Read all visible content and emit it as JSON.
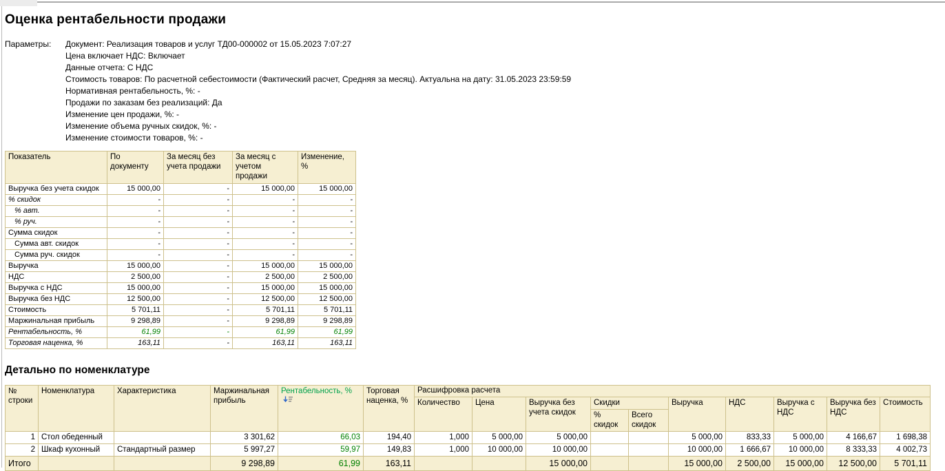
{
  "page": {
    "title": "Оценка рентабельности продажи",
    "section_heading": "Детально по номенклатуре"
  },
  "icons": {
    "sort": "sort-descending-icon"
  },
  "colors": {
    "header_bg": "#f6efd2",
    "grid_border": "#cdc08b",
    "green_value": "#008000",
    "green_header": "#00a14b",
    "sort_arrow": "#2e66c9"
  },
  "parameters": {
    "label": "Параметры:",
    "lines": [
      "Документ: Реализация товаров и услуг ТД00-000002 от 15.05.2023 7:07:27",
      "Цена включает НДС: Включает",
      "Данные отчета: С НДС",
      "Стоимость товаров: По расчетной себестоимости (Фактический расчет, Средняя за месяц). Актуальна на дату: 31.05.2023 23:59:59",
      "Нормативная рентабельность, %: -",
      "Продажи по заказам без реализаций: Да",
      "Изменение цен продажи, %: -",
      "Изменение объема ручных скидок, %: -",
      "Изменение стоимости товаров, %: -"
    ]
  },
  "summary_table": {
    "columns": [
      "Показатель",
      "По документу",
      "За месяц без учета продажи",
      "За месяц с учетом продажи",
      "Изменение, %"
    ],
    "rows": [
      {
        "label": "Выручка без учета скидок",
        "indent": 0,
        "italic": false,
        "green": false,
        "values": [
          "15 000,00",
          "-",
          "15 000,00",
          "15 000,00"
        ]
      },
      {
        "label": "% скидок",
        "indent": 0,
        "italic": true,
        "green": false,
        "values": [
          "-",
          "-",
          "-",
          "-"
        ]
      },
      {
        "label": "% авт.",
        "indent": 1,
        "italic": true,
        "green": false,
        "values": [
          "-",
          "-",
          "-",
          "-"
        ]
      },
      {
        "label": "% руч.",
        "indent": 1,
        "italic": true,
        "green": false,
        "values": [
          "-",
          "-",
          "-",
          "-"
        ]
      },
      {
        "label": "Сумма скидок",
        "indent": 0,
        "italic": false,
        "green": false,
        "values": [
          "-",
          "-",
          "-",
          "-"
        ]
      },
      {
        "label": "Сумма авт. скидок",
        "indent": 1,
        "italic": false,
        "green": false,
        "values": [
          "-",
          "-",
          "-",
          "-"
        ]
      },
      {
        "label": "Сумма руч. скидок",
        "indent": 1,
        "italic": false,
        "green": false,
        "values": [
          "-",
          "-",
          "-",
          "-"
        ]
      },
      {
        "label": "Выручка",
        "indent": 0,
        "italic": false,
        "green": false,
        "values": [
          "15 000,00",
          "-",
          "15 000,00",
          "15 000,00"
        ]
      },
      {
        "label": "НДС",
        "indent": 0,
        "italic": false,
        "green": false,
        "values": [
          "2 500,00",
          "-",
          "2 500,00",
          "2 500,00"
        ]
      },
      {
        "label": "Выручка с НДС",
        "indent": 0,
        "italic": false,
        "green": false,
        "values": [
          "15 000,00",
          "-",
          "15 000,00",
          "15 000,00"
        ]
      },
      {
        "label": "Выручка без НДС",
        "indent": 0,
        "italic": false,
        "green": false,
        "values": [
          "12 500,00",
          "-",
          "12 500,00",
          "12 500,00"
        ]
      },
      {
        "label": "Стоимость",
        "indent": 0,
        "italic": false,
        "green": false,
        "values": [
          "5 701,11",
          "-",
          "5 701,11",
          "5 701,11"
        ]
      },
      {
        "label": "Маржинальная прибыль",
        "indent": 0,
        "italic": false,
        "green": false,
        "values": [
          "9 298,89",
          "-",
          "9 298,89",
          "9 298,89"
        ]
      },
      {
        "label": "Рентабельность, %",
        "indent": 0,
        "italic": true,
        "green": true,
        "values": [
          "61,99",
          "-",
          "61,99",
          "61,99"
        ]
      },
      {
        "label": "Торговая наценка, %",
        "indent": 0,
        "italic": true,
        "green": false,
        "values": [
          "163,11",
          "-",
          "163,11",
          "163,11"
        ]
      }
    ]
  },
  "detail_table": {
    "left_columns": [
      "№ строки",
      "Номенклатура",
      "Характеристика",
      "Маржинальная прибыль",
      "Рентабельность, %",
      "Торговая наценка, %"
    ],
    "sorted_column": "Рентабельность, %",
    "group_label": "Расшифровка расчета",
    "sub_columns_before": [
      "Количество",
      "Цена",
      "Выручка без учета скидок"
    ],
    "discounts_group": {
      "label": "Скидки",
      "children": [
        "% скидок",
        "Всего скидок"
      ]
    },
    "sub_columns_after": [
      "Выручка",
      "НДС",
      "Выручка с НДС",
      "Выручка без НДС",
      "Стоимость"
    ],
    "rows": [
      [
        "1",
        "Стол обеденный",
        "",
        "3 301,62",
        "66,03",
        "194,40",
        "1,000",
        "5 000,00",
        "5 000,00",
        "",
        "",
        "5 000,00",
        "833,33",
        "5 000,00",
        "4 166,67",
        "1 698,38"
      ],
      [
        "2",
        "Шкаф кухонный",
        "Стандартный размер",
        "5 997,27",
        "59,97",
        "149,83",
        "1,000",
        "10 000,00",
        "10 000,00",
        "",
        "",
        "10 000,00",
        "1 666,67",
        "10 000,00",
        "8 333,33",
        "4 002,73"
      ]
    ],
    "total_row": [
      "Итого",
      "",
      "",
      "9 298,89",
      "61,99",
      "163,11",
      "",
      "",
      "15 000,00",
      "",
      "",
      "15 000,00",
      "2 500,00",
      "15 000,00",
      "12 500,00",
      "5 701,11"
    ]
  }
}
